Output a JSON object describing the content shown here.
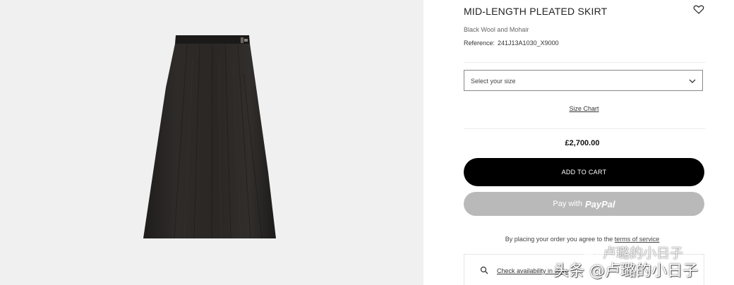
{
  "product": {
    "title": "MID-LENGTH PLEATED SKIRT",
    "material": "Black Wool and Mohair",
    "reference_label": "Reference:",
    "reference_value": "241J13A1030_X9000",
    "size_placeholder": "Select your size",
    "size_chart": "Size Chart",
    "price": "£2,700.00",
    "add_to_cart": "ADD TO CART",
    "paypal_prefix": "Pay with",
    "paypal_brand": "PayPal",
    "terms_prefix": "By placing your order you agree to the",
    "terms_link": "terms of service",
    "availability_link": "Check availability in store"
  },
  "watermarks": {
    "wechat": "卢璐的小日子",
    "toutiao": "头条 @卢璐的小日子"
  },
  "icons": {
    "favorite": "heart-icon",
    "dropdown": "chevron-down-icon",
    "search": "search-icon",
    "wechat": "wechat-icon"
  },
  "colors": {
    "cart_button": "#000000",
    "paypal_button": "#b9b9b9",
    "gallery_bg": "#f0f0f0",
    "skirt": "#2b2826"
  }
}
